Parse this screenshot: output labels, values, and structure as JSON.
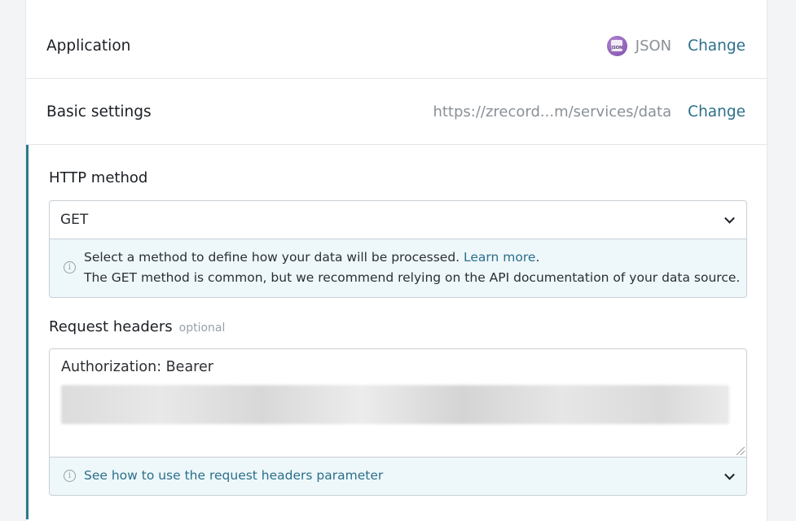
{
  "rows": {
    "application": {
      "title": "Application",
      "value": "JSON",
      "icon": "json-app-icon",
      "icon_text": "JSON",
      "change": "Change"
    },
    "basic": {
      "title": "Basic settings",
      "value": "https://zrecord...m/services/data",
      "change": "Change"
    }
  },
  "http_method": {
    "label": "HTTP method",
    "selected": "GET",
    "info_line1": "Select a method to define how your data will be processed.",
    "learn_more": "Learn more",
    "info_period": ".",
    "info_line2": "The GET method is common, but we recommend relying on the API documentation of your data source."
  },
  "request_headers": {
    "label": "Request headers",
    "optional": "optional",
    "value_line1": "Authorization: Bearer",
    "help": "See how to use the request headers parameter"
  },
  "colors": {
    "accent": "#2b6f8a",
    "section_border": "#2b7a8a",
    "info_bg": "#eef7fa"
  }
}
